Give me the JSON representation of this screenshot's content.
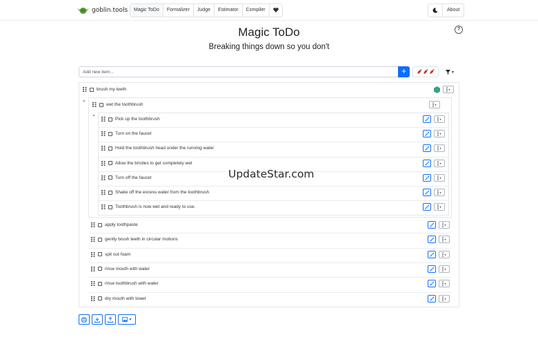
{
  "nav": {
    "brand": "goblin.tools",
    "tools": [
      {
        "label": "Magic ToDo",
        "active": true
      },
      {
        "label": "Formalizer",
        "active": false
      },
      {
        "label": "Judge",
        "active": false
      },
      {
        "label": "Estimator",
        "active": false
      },
      {
        "label": "Compiler",
        "active": false
      }
    ],
    "heart_icon": "heart-icon",
    "theme_icon": "moon-icon",
    "about": "About"
  },
  "header": {
    "title": "Magic ToDo",
    "subtitle": "Breaking things down so you don't",
    "help": "?"
  },
  "add": {
    "placeholder": "Add new item...",
    "button": "+",
    "spiciness": 3
  },
  "tasks": {
    "root": "brush my teeth",
    "child1": "wet the toothbrush",
    "sub": [
      "Pick up the toothbrush",
      "Turn on the faucet",
      "Hold the toothbrush head under the running water",
      "Allow the bristles to get completely wet",
      "Turn off the faucet",
      "Shake off the excess water from the toothbrush",
      "Toothbrush is now wet and ready to use."
    ],
    "siblings": [
      "apply toothpaste",
      "gently brush teeth in circular motions",
      "spit out foam",
      "rinse mouth with water",
      "rinse toothbrush with water",
      "dry mouth with towel"
    ]
  },
  "watermark": "UpdateStar.com",
  "colors": {
    "accent": "#0d6efd",
    "pepper": "#c0392b",
    "goblin": "#5a9a2a"
  }
}
